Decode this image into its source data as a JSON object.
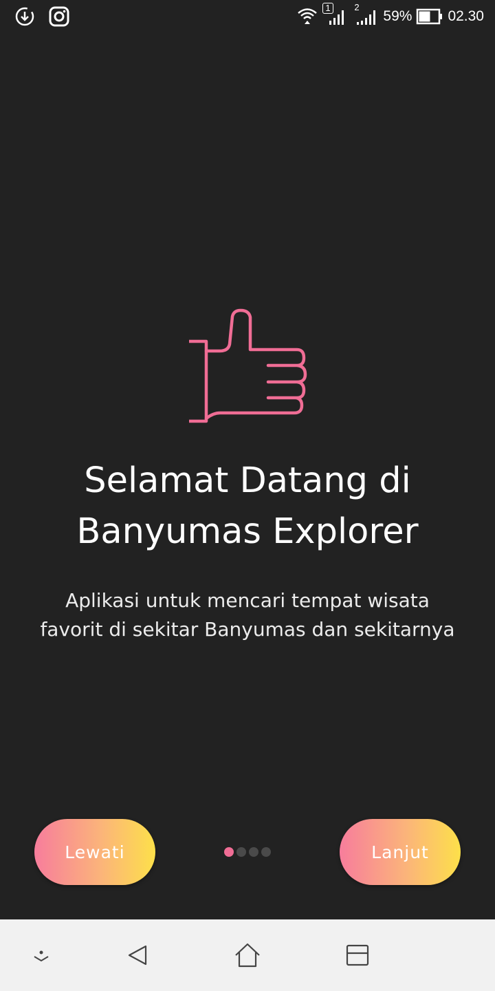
{
  "status_bar": {
    "left_icons": [
      "download-sync-icon",
      "instagram-icon"
    ],
    "right_icons": [
      "wifi-icon",
      "sim1-signal-icon",
      "sim2-signal-icon",
      "battery-icon"
    ],
    "sim1_label": "1",
    "sim2_label": "2",
    "battery_percent": "59%",
    "time": "02.30"
  },
  "onboarding": {
    "hero_icon": "thumbs-up-icon",
    "title_line1": "Selamat Datang di",
    "title_line2": "Banyumas Explorer",
    "subtitle_line1": "Aplikasi untuk mencari tempat wisata",
    "subtitle_line2": "favorit di sekitar Banyumas dan sekitarnya",
    "skip_label": "Lewati",
    "next_label": "Lanjut",
    "page_count": 4,
    "current_page": 1
  },
  "nav_bar": {
    "buttons": [
      "hide-nav-icon",
      "back-icon",
      "home-icon",
      "recents-icon"
    ]
  },
  "colors": {
    "background": "#222222",
    "accent_pink": "#f06d95",
    "gradient_start": "#f77d9c",
    "gradient_end": "#fde04a",
    "nav_bar": "#f1f1f1"
  }
}
